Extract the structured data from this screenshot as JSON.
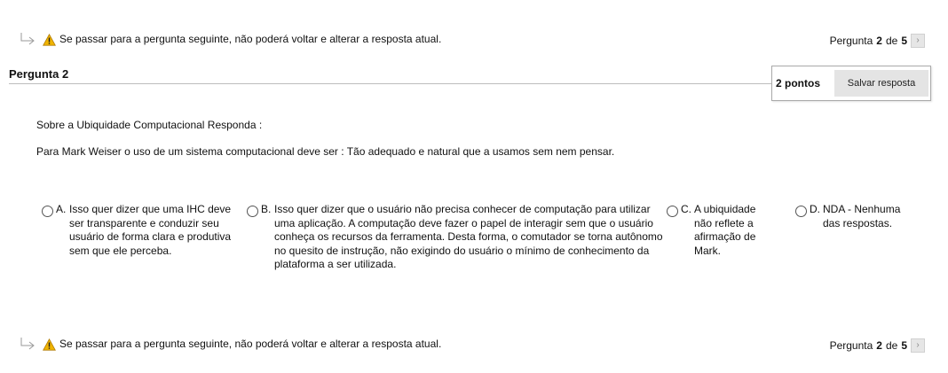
{
  "warning": {
    "text": "Se passar para a pergunta seguinte, não poderá voltar e alterar a resposta atual."
  },
  "pager": {
    "prefix": "Pergunta",
    "current": "2",
    "separator": "de",
    "total": "5",
    "next_icon": "chevron-right-icon"
  },
  "question": {
    "title": "Pergunta 2",
    "points": "2 pontos",
    "save_label": "Salvar resposta",
    "prompt_line1": "Sobre a Ubiquidade Computacional Responda :",
    "prompt_line2": "Para Mark Weiser o uso de um sistema computacional deve ser :  Tão adequado e natural que a usamos sem nem pensar."
  },
  "options": [
    {
      "letter": "A.",
      "text": "Isso quer dizer que uma IHC deve ser transparente e conduzir seu usuário de forma clara e produtiva sem que ele perceba."
    },
    {
      "letter": "B.",
      "text": "Isso quer dizer que o usuário não precisa conhecer de computação para utilizar uma aplicação. A computação deve fazer o papel de interagir sem que o usuário conheça os recursos da ferramenta. Desta forma, o comutador se torna autônomo no quesito de instrução, não exigindo do usuário o mínimo de conhecimento da plataforma a ser utilizada."
    },
    {
      "letter": "C.",
      "text": "A ubiquidade não reflete a afirmação de Mark."
    },
    {
      "letter": "D.",
      "text": "NDA - Nenhuma das respostas."
    }
  ],
  "colors": {
    "warning_fill": "#f0b400",
    "rule": "#bdbdbd",
    "button_bg": "#e4e4e4"
  }
}
